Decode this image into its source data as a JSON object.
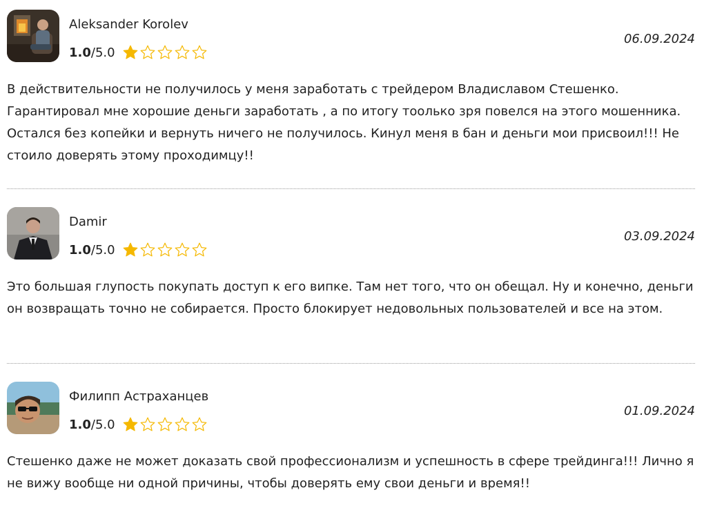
{
  "rating_colors": {
    "filled": "#f5b800",
    "outline": "#f5b800"
  },
  "reviews": [
    {
      "author": "Aleksander Korolev",
      "avatar_icon": "avatar-photo-man-sitting-by-fireplace",
      "rating_value": "1.0",
      "rating_max": "/5.0",
      "stars_filled": 1,
      "stars_total": 5,
      "date": "06.09.2024",
      "text": "В действительности не получилось у меня заработать с трейдером Владиславом Стешенко. Гарантировал мне хорошие деньги заработать , а по итогу тоолько зря повелся на этого мошенника. Остался без копейки и вернуть ничего не получилось. Кинул меня в бан и деньги мои присвоил!!! Не стоило доверять этому проходимцу!!"
    },
    {
      "author": "Damir",
      "avatar_icon": "avatar-photo-man-in-suit",
      "rating_value": "1.0",
      "rating_max": "/5.0",
      "stars_filled": 1,
      "stars_total": 5,
      "date": "03.09.2024",
      "text": "Это большая глупость покупать доступ к его випке. Там нет того, что он обещал. Ну и конечно, деньги он возвращать точно не собирается. Просто блокирует недовольных пользователей и все на этом."
    },
    {
      "author": "Филипп Астраханцев",
      "avatar_icon": "avatar-photo-man-in-sunglasses",
      "rating_value": "1.0",
      "rating_max": "/5.0",
      "stars_filled": 1,
      "stars_total": 5,
      "date": "01.09.2024",
      "text": "Стешенко даже не может доказать свой профессионализм и успешность в сфере трейдинга!!! Лично я не вижу вообще ни одной причины, чтобы доверять ему свои деньги и время!!"
    }
  ]
}
